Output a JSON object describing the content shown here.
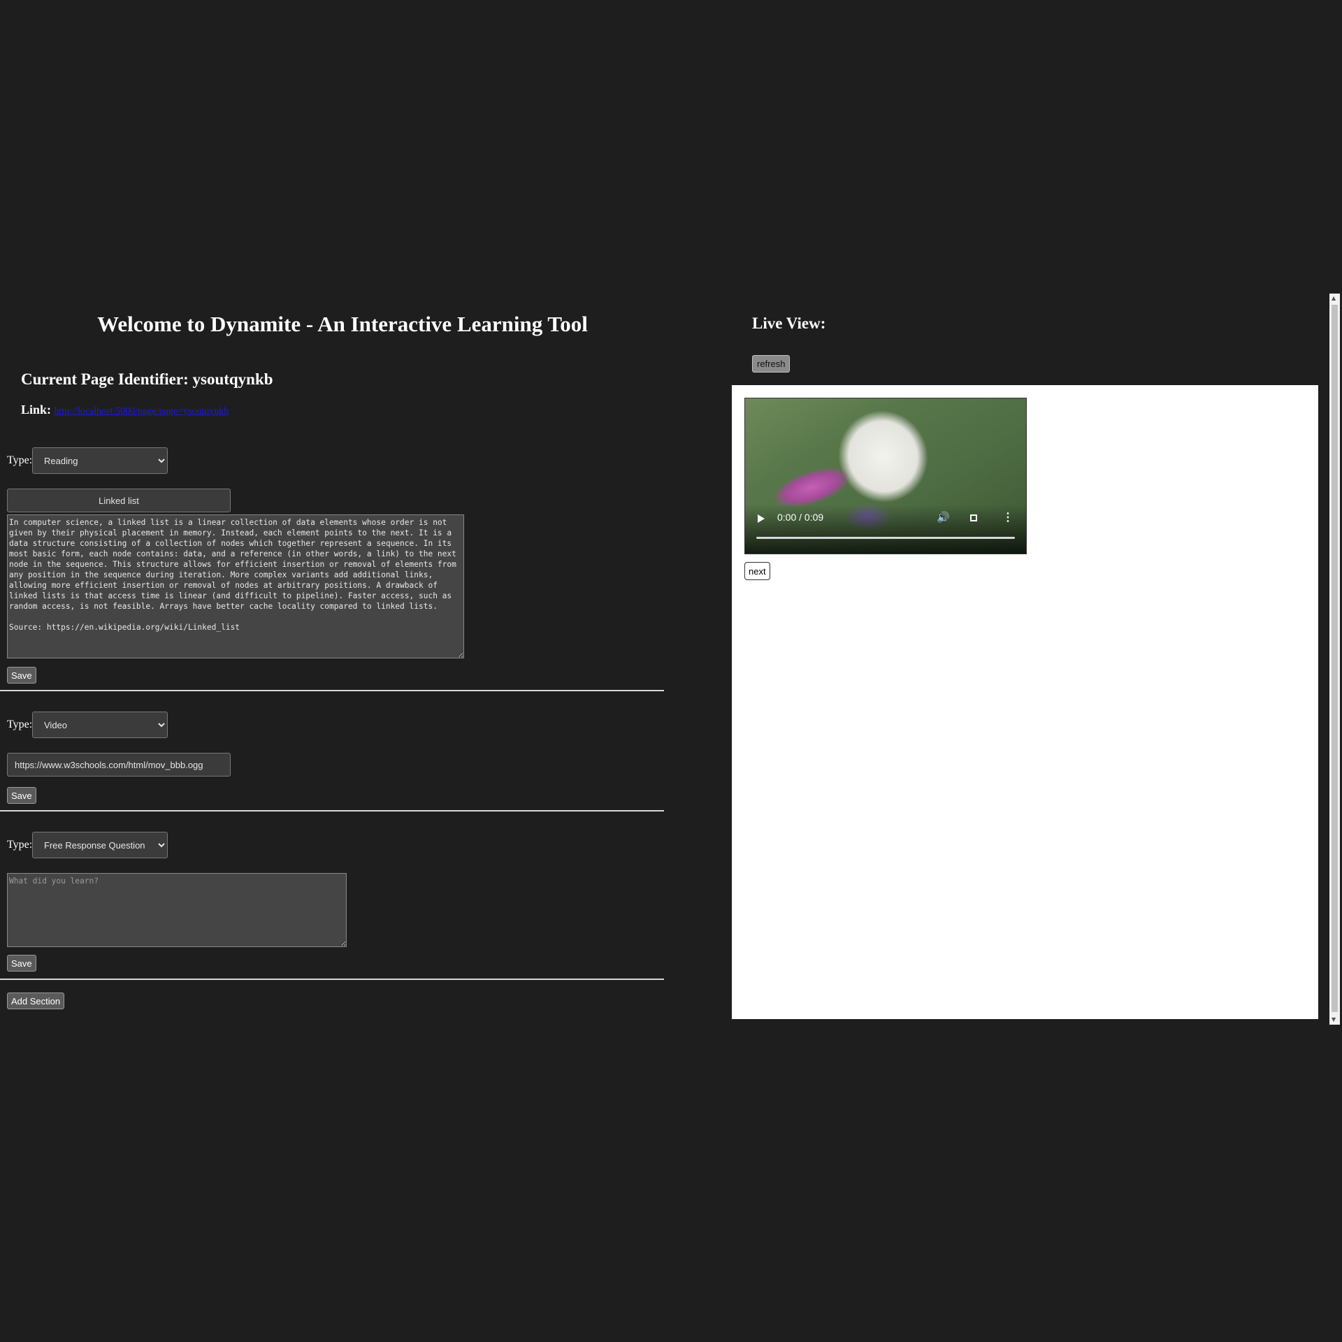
{
  "header": {
    "title": "Welcome to Dynamite - An Interactive Learning Tool",
    "page_identifier": "Current Page Identifier: ysoutqynkb",
    "link_label": "Link:",
    "link_url": "http://localhost:5000/page/page=ysoutqynkb"
  },
  "sections": [
    {
      "type_label": "Type:",
      "type_value": "Reading",
      "title_value": "Linked list",
      "body": "In computer science, a linked list is a linear collection of data elements whose order is not given by their physical placement in memory. Instead, each element points to the next. It is a data structure consisting of a collection of nodes which together represent a sequence. In its most basic form, each node contains: data, and a reference (in other words, a link) to the next node in the sequence. This structure allows for efficient insertion or removal of elements from any position in the sequence during iteration. More complex variants add additional links, allowing more efficient insertion or removal of nodes at arbitrary positions. A drawback of linked lists is that access time is linear (and difficult to pipeline). Faster access, such as random access, is not feasible. Arrays have better cache locality compared to linked lists.\n\nSource: https://en.wikipedia.org/wiki/Linked_list",
      "save_label": "Save"
    },
    {
      "type_label": "Type:",
      "type_value": "Video",
      "url_value": "https://www.w3schools.com/html/mov_bbb.ogg",
      "save_label": "Save"
    },
    {
      "type_label": "Type:",
      "type_value": "Free Response Question",
      "question_placeholder": "What did you learn?",
      "save_label": "Save"
    }
  ],
  "add_section_label": "Add Section",
  "live_view": {
    "title": "Live View:",
    "refresh_label": "refresh",
    "video_time": "0:00 / 0:09",
    "video_progress": 0,
    "next_label": "next"
  }
}
